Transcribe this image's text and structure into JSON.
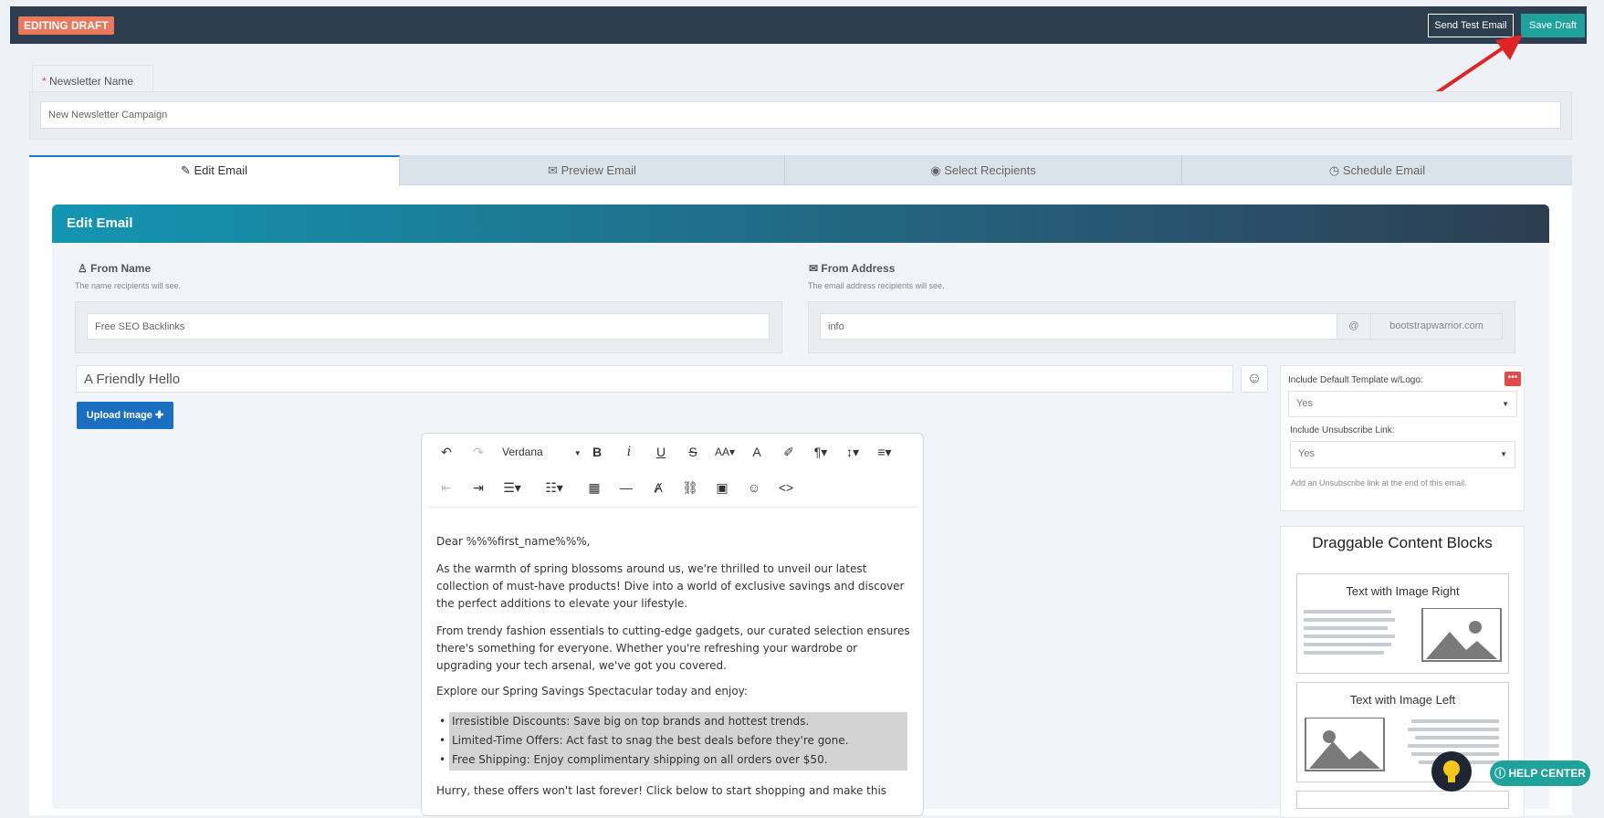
{
  "topbar": {
    "badge": "EDITING DRAFT",
    "send_test": "Send Test Email",
    "save_draft": "Save Draft"
  },
  "newsletter": {
    "label": "Newsletter Name",
    "required_mark": "*",
    "value": "New Newsletter Campaign"
  },
  "tabs": [
    {
      "label": "Edit Email",
      "icon": "edit-icon"
    },
    {
      "label": "Preview Email",
      "icon": "envelope-open-icon"
    },
    {
      "label": "Select Recipients",
      "icon": "user-circle-icon"
    },
    {
      "label": "Schedule Email",
      "icon": "clock-icon"
    }
  ],
  "section": {
    "title": "Edit Email"
  },
  "from_name": {
    "label": "From Name",
    "hint": "The name recipients will see.",
    "value": "Free SEO Backlinks"
  },
  "from_address": {
    "label": "From Address",
    "hint": "The email address recipients will see.",
    "local": "info",
    "at": "@",
    "domain": "bootstrapwarrior.com"
  },
  "subject": {
    "value": "A Friendly Hello"
  },
  "upload": {
    "label": "Upload Image"
  },
  "editor": {
    "font": "Verdana",
    "greeting": "Dear %%%first_name%%%,",
    "p1": "As the warmth of spring blossoms around us, we're thrilled to unveil our latest collection of must-have products! Dive into a world of exclusive savings and discover the perfect additions to elevate your lifestyle.",
    "p2": "From trendy fashion essentials to cutting-edge gadgets, our curated selection ensures there's something for everyone. Whether you're refreshing your wardrobe or upgrading your tech arsenal, we've got you covered.",
    "p3": "Explore our Spring Savings Spectacular today and enjoy:",
    "bullets": [
      "Irresistible Discounts: Save big on top brands and hottest trends.",
      "Limited-Time Offers: Act fast to snag the best deals before they're gone.",
      "Free Shipping: Enjoy complimentary shipping on all orders over $50."
    ],
    "p4": "Hurry, these offers won't last forever! Click below to start shopping and make this"
  },
  "settings": {
    "template_label": "Include Default Template w/Logo:",
    "template_value": "Yes",
    "unsub_label": "Include Unsubscribe Link:",
    "unsub_value": "Yes",
    "unsub_hint": "Add an Unsubscribe link at the end of this email."
  },
  "blocks": {
    "title": "Draggable Content Blocks",
    "items": [
      "Text with Image Right",
      "Text with Image Left"
    ]
  },
  "help": {
    "label": "HELP CENTER"
  },
  "colors": {
    "topbar": "#2c3e50",
    "save": "#1fa29a",
    "badge": "#e8795a",
    "arrow": "#e02424"
  }
}
